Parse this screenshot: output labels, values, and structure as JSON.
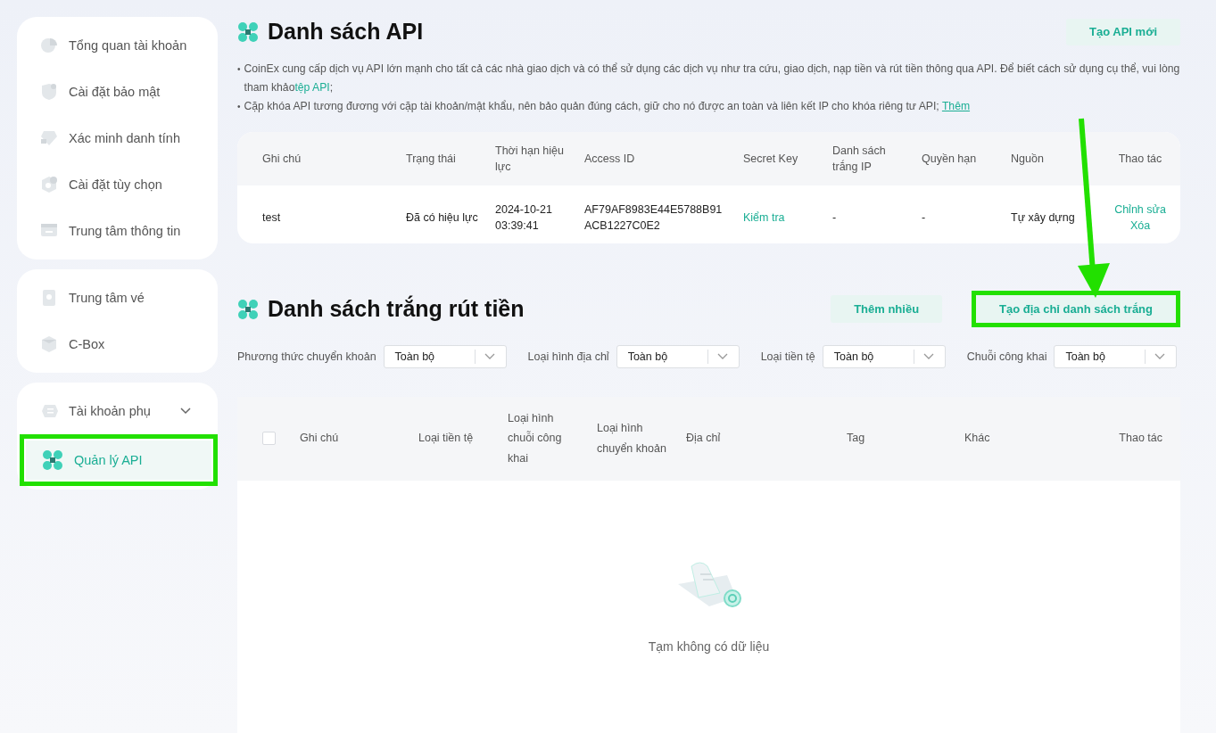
{
  "sidebar": {
    "groups": [
      {
        "items": [
          {
            "label": "Tổng quan tài khoản",
            "kind": "link",
            "selected": false,
            "highlighted": false
          },
          {
            "label": "Cài đặt bảo mật",
            "kind": "link",
            "selected": false,
            "highlighted": false
          },
          {
            "label": "Xác minh danh tính",
            "kind": "link",
            "selected": false,
            "highlighted": false
          },
          {
            "label": "Cài đặt tùy chọn",
            "kind": "link",
            "selected": false,
            "highlighted": false
          },
          {
            "label": "Trung tâm thông tin",
            "kind": "link",
            "selected": false,
            "highlighted": false
          }
        ]
      },
      {
        "items": [
          {
            "label": "Trung tâm vé",
            "kind": "link",
            "selected": false,
            "highlighted": false
          },
          {
            "label": "C-Box",
            "kind": "link",
            "selected": false,
            "highlighted": false
          }
        ]
      },
      {
        "items": [
          {
            "label": "Tài khoản phụ",
            "kind": "expandable",
            "selected": false,
            "highlighted": false
          },
          {
            "label": "Quản lý API",
            "kind": "link",
            "selected": true,
            "highlighted": true
          }
        ]
      }
    ]
  },
  "api_section": {
    "title": "Danh sách API",
    "create_button": "Tạo API mới",
    "notes": [
      {
        "marker": "•",
        "text": "CoinEx cung cấp dịch vụ API lớn mạnh cho tất cả các nhà giao dịch và có thể sử dụng các dịch vụ như tra cứu, giao dịch, nạp tiền và rút tiền thông qua API. Để biết cách sử dụng cụ thể, vui lòng tham khảo",
        "link": "tệp API",
        "after": ";",
        "underlined": false
      },
      {
        "marker": "•",
        "text": "Cặp khóa API tương đương với cặp tài khoản/mật khẩu, nên bảo quản đúng cách, giữ cho nó được an toàn và liên kết IP cho khóa riêng tư API; ",
        "link": "Thêm",
        "underlined": true
      }
    ],
    "table": {
      "columns": [
        "Ghi chú",
        "Trạng thái",
        "Thời hạn hiệu lực",
        "Access ID",
        "Secret Key",
        "Danh sách trắng IP",
        "Quyền hạn",
        "Nguồn",
        "Thao tác"
      ],
      "rows": [
        {
          "note": "test",
          "status": "Đã có hiệu lực",
          "expiry": "2024-10-21 03:39:41",
          "access_id": "AF79AF8983E44E5788B91ACB1227C0E2",
          "secret_key": "Kiểm tra",
          "ip_whitelist": "-",
          "permissions": "-",
          "source": "Tự xây dựng",
          "actions": [
            "Chỉnh sửa",
            "Xóa"
          ]
        }
      ]
    }
  },
  "whitelist_section": {
    "title": "Danh sách trắng rút tiền",
    "buttons": [
      {
        "label": "Thêm nhiều",
        "highlighted": false
      },
      {
        "label": "Tạo địa chỉ danh sách trắng",
        "highlighted": true
      }
    ],
    "filters": [
      {
        "label": "Phương thức chuyển khoản",
        "value": "Toàn bộ"
      },
      {
        "label": "Loại hình địa chỉ",
        "value": "Toàn bộ"
      },
      {
        "label": "Loại tiền tệ",
        "value": "Toàn bộ"
      },
      {
        "label": "Chuỗi công khai",
        "value": "Toàn bộ"
      }
    ],
    "table": {
      "select_all": false,
      "columns": [
        "Ghi chú",
        "Loại tiền tệ",
        "Loại hình chuỗi công khai",
        "Loại hình chuyển khoản",
        "Địa chỉ",
        "Tag",
        "Khác",
        "Thao tác"
      ],
      "empty_text": "Tạm không có dữ liệu"
    }
  },
  "annotation_arrow": {
    "shown": true
  }
}
